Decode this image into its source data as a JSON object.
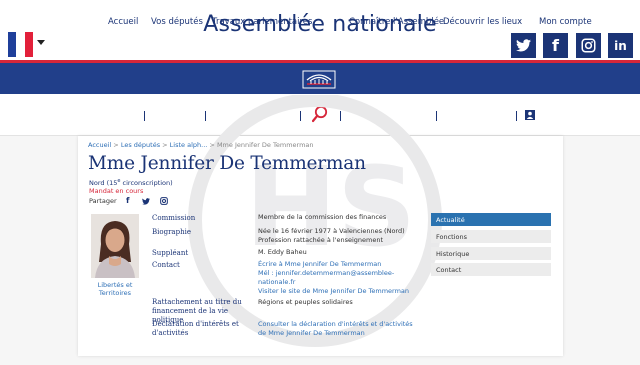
{
  "site": {
    "title": "Assemblée nationale"
  },
  "colors": {
    "primary": "#1b3476",
    "accent": "#d6273a",
    "tab_active": "#2a72b0"
  },
  "social": [
    {
      "name": "twitter",
      "glyph": "🐦"
    },
    {
      "name": "facebook",
      "glyph": "f"
    },
    {
      "name": "instagram",
      "glyph": "◎"
    },
    {
      "name": "linkedin",
      "glyph": "in"
    }
  ],
  "nav": {
    "items": [
      "Accueil",
      "Vos députés",
      "Travaux parlementaires",
      "Connaître l'Assemblée",
      "Découvrir les lieux",
      "Mon compte"
    ]
  },
  "breadcrumb": {
    "items": [
      "Accueil",
      "Les députés",
      "Liste alph...",
      "Mme Jennifer De Temmerman"
    ],
    "sep": " > "
  },
  "deputy": {
    "name": "Mme Jennifer De Temmerman",
    "circonscription": "Nord (15e circonscription)",
    "mandat": "Mandat en cours",
    "share_label": "Partager",
    "group": "Libertés et Territoires"
  },
  "details": [
    {
      "label": "Commission",
      "lines": [
        "Membre de la commission des finances"
      ],
      "link": false
    },
    {
      "label": "Biographie",
      "lines": [
        "Née le 16 février 1977 à Valenciennes (Nord)",
        "Profession rattachée à l'enseignement"
      ],
      "link": false
    },
    {
      "label": "Suppléant",
      "lines": [
        "M. Eddy Baheu"
      ],
      "link": false
    },
    {
      "label": "Contact",
      "lines": [
        "Écrire à Mme Jennifer De Temmerman",
        "Mél : jennifer.detemmerman@assemblee-",
        "nationale.fr",
        "Visiter le site de Mme Jennifer De Temmerman"
      ],
      "link": true
    },
    {
      "label": "Rattachement au titre du financement de la vie politique",
      "lines": [
        "Régions et peuples solidaires"
      ],
      "link": false
    },
    {
      "label": "Déclaration d'intérêts et d'activités",
      "lines": [
        "Consulter la déclaration d'intérêts et d'activités",
        "de Mme Jennifer De Temmerman"
      ],
      "link": true
    }
  ],
  "tabs": [
    {
      "label": "Actualité",
      "active": true
    },
    {
      "label": "Fonctions",
      "active": false
    },
    {
      "label": "Historique",
      "active": false
    },
    {
      "label": "Contact",
      "active": false
    }
  ]
}
